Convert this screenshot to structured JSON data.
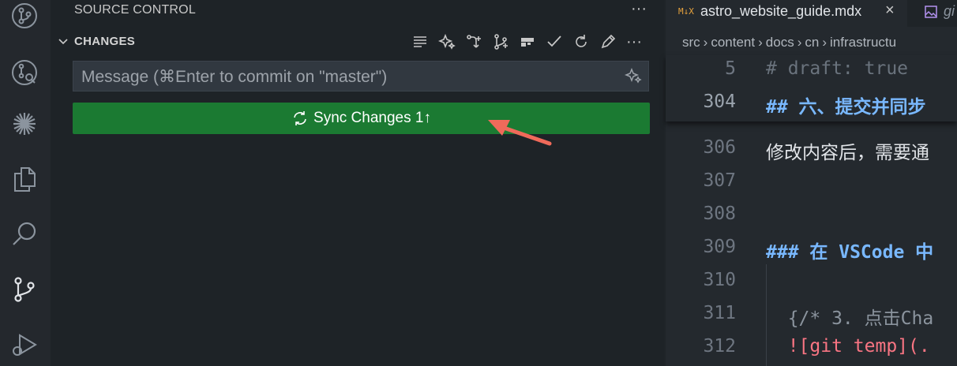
{
  "activity_bar": {
    "icons": [
      "source-control-graph-icon",
      "git-lens-icon",
      "sparkle-star-icon",
      "explorer-files-icon",
      "search-icon",
      "source-control-icon",
      "run-debug-icon"
    ]
  },
  "source_control": {
    "title": "SOURCE CONTROL",
    "more": "···",
    "changes_label": "CHANGES",
    "message_placeholder": "Message (⌘Enter to commit on \"master\")",
    "sync_label": "Sync Changes 1↑"
  },
  "editor": {
    "tab_active_icon": "M↓X",
    "tab_active_label": "astro_website_guide.mdx",
    "tab_close": "×",
    "tab_second_label": "gi",
    "breadcrumb": [
      "src",
      "content",
      "docs",
      "cn",
      "infrastructu"
    ],
    "sticky_lines": [
      {
        "num": "5",
        "text": "# draft: true"
      },
      {
        "num": "304",
        "text": "## 六、提交并同步"
      }
    ],
    "lines": [
      {
        "num": "306",
        "text": "修改内容后，需要通"
      },
      {
        "num": "307",
        "text": ""
      },
      {
        "num": "308",
        "text": ""
      },
      {
        "num": "309",
        "text": "### 在 VSCode 中"
      },
      {
        "num": "310",
        "text": ""
      },
      {
        "num": "311",
        "text": "  {/* 3. 点击Cha"
      },
      {
        "num": "312",
        "text": "  ![git temp](."
      }
    ]
  },
  "colors": {
    "sync_button": "#1b7a32",
    "heading": "#79b8ff",
    "comment": "#6a737d",
    "link_red": "#f97583",
    "annotation_arrow": "#f06a5a"
  }
}
